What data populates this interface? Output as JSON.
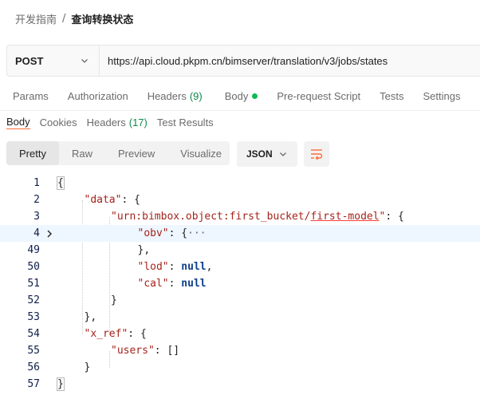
{
  "breadcrumb": {
    "parent": "开发指南",
    "separator": "/",
    "current": "查询转换状态"
  },
  "request": {
    "method": "POST",
    "url": "https://api.cloud.pkpm.cn/bimserver/translation/v3/jobs/states"
  },
  "request_tabs": [
    {
      "label": "Params"
    },
    {
      "label": "Authorization"
    },
    {
      "label": "Headers",
      "count": "(9)"
    },
    {
      "label": "Body"
    },
    {
      "label": "Pre-request Script"
    },
    {
      "label": "Tests"
    },
    {
      "label": "Settings"
    }
  ],
  "response_tabs": [
    {
      "label": "Body"
    },
    {
      "label": "Cookies"
    },
    {
      "label": "Headers",
      "count": "(17)"
    },
    {
      "label": "Test Results"
    }
  ],
  "view_modes": [
    "Pretty",
    "Raw",
    "Preview",
    "Visualize"
  ],
  "format": "JSON",
  "icons": {
    "method_chevron": "chevron-down-icon",
    "format_chevron": "chevron-down-icon",
    "wrap": "wrap-lines-icon",
    "fold": "chevron-right-icon"
  },
  "colors": {
    "accent": "#ff6c37",
    "count_green": "#0b8a4a",
    "body_dot": "#0cbb52"
  },
  "code": {
    "line_numbers": [
      "1",
      "2",
      "3",
      "4",
      "49",
      "50",
      "51",
      "52",
      "53",
      "54",
      "55",
      "56",
      "57"
    ],
    "lines": [
      {
        "indent": 0,
        "tokens": [
          [
            "p",
            "{"
          ]
        ]
      },
      {
        "indent": 1,
        "tokens": [
          [
            "k",
            "\"data\""
          ],
          [
            "p",
            ": {"
          ]
        ]
      },
      {
        "indent": 2,
        "tokens": [
          [
            "k",
            "\"urn:bimbox.object:first_bucket/first-model\""
          ],
          [
            "p",
            ": {"
          ]
        ]
      },
      {
        "indent": 3,
        "tokens": [
          [
            "k",
            "\"obv\""
          ],
          [
            "p",
            ": {"
          ],
          [
            "e",
            "···"
          ]
        ]
      },
      {
        "indent": 3,
        "tokens": [
          [
            "p",
            "},"
          ]
        ]
      },
      {
        "indent": 3,
        "tokens": [
          [
            "k",
            "\"lod\""
          ],
          [
            "p",
            ": "
          ],
          [
            "n",
            "null"
          ],
          [
            "p",
            ","
          ]
        ]
      },
      {
        "indent": 3,
        "tokens": [
          [
            "k",
            "\"cal\""
          ],
          [
            "p",
            ": "
          ],
          [
            "n",
            "null"
          ]
        ]
      },
      {
        "indent": 2,
        "tokens": [
          [
            "p",
            "}"
          ]
        ]
      },
      {
        "indent": 1,
        "tokens": [
          [
            "p",
            "},"
          ]
        ]
      },
      {
        "indent": 1,
        "tokens": [
          [
            "k",
            "\"x_ref\""
          ],
          [
            "p",
            ": {"
          ]
        ]
      },
      {
        "indent": 2,
        "tokens": [
          [
            "k",
            "\"users\""
          ],
          [
            "p",
            ": []"
          ]
        ]
      },
      {
        "indent": 1,
        "tokens": [
          [
            "p",
            "}"
          ]
        ]
      },
      {
        "indent": 0,
        "tokens": [
          [
            "p",
            "}"
          ]
        ]
      }
    ]
  }
}
